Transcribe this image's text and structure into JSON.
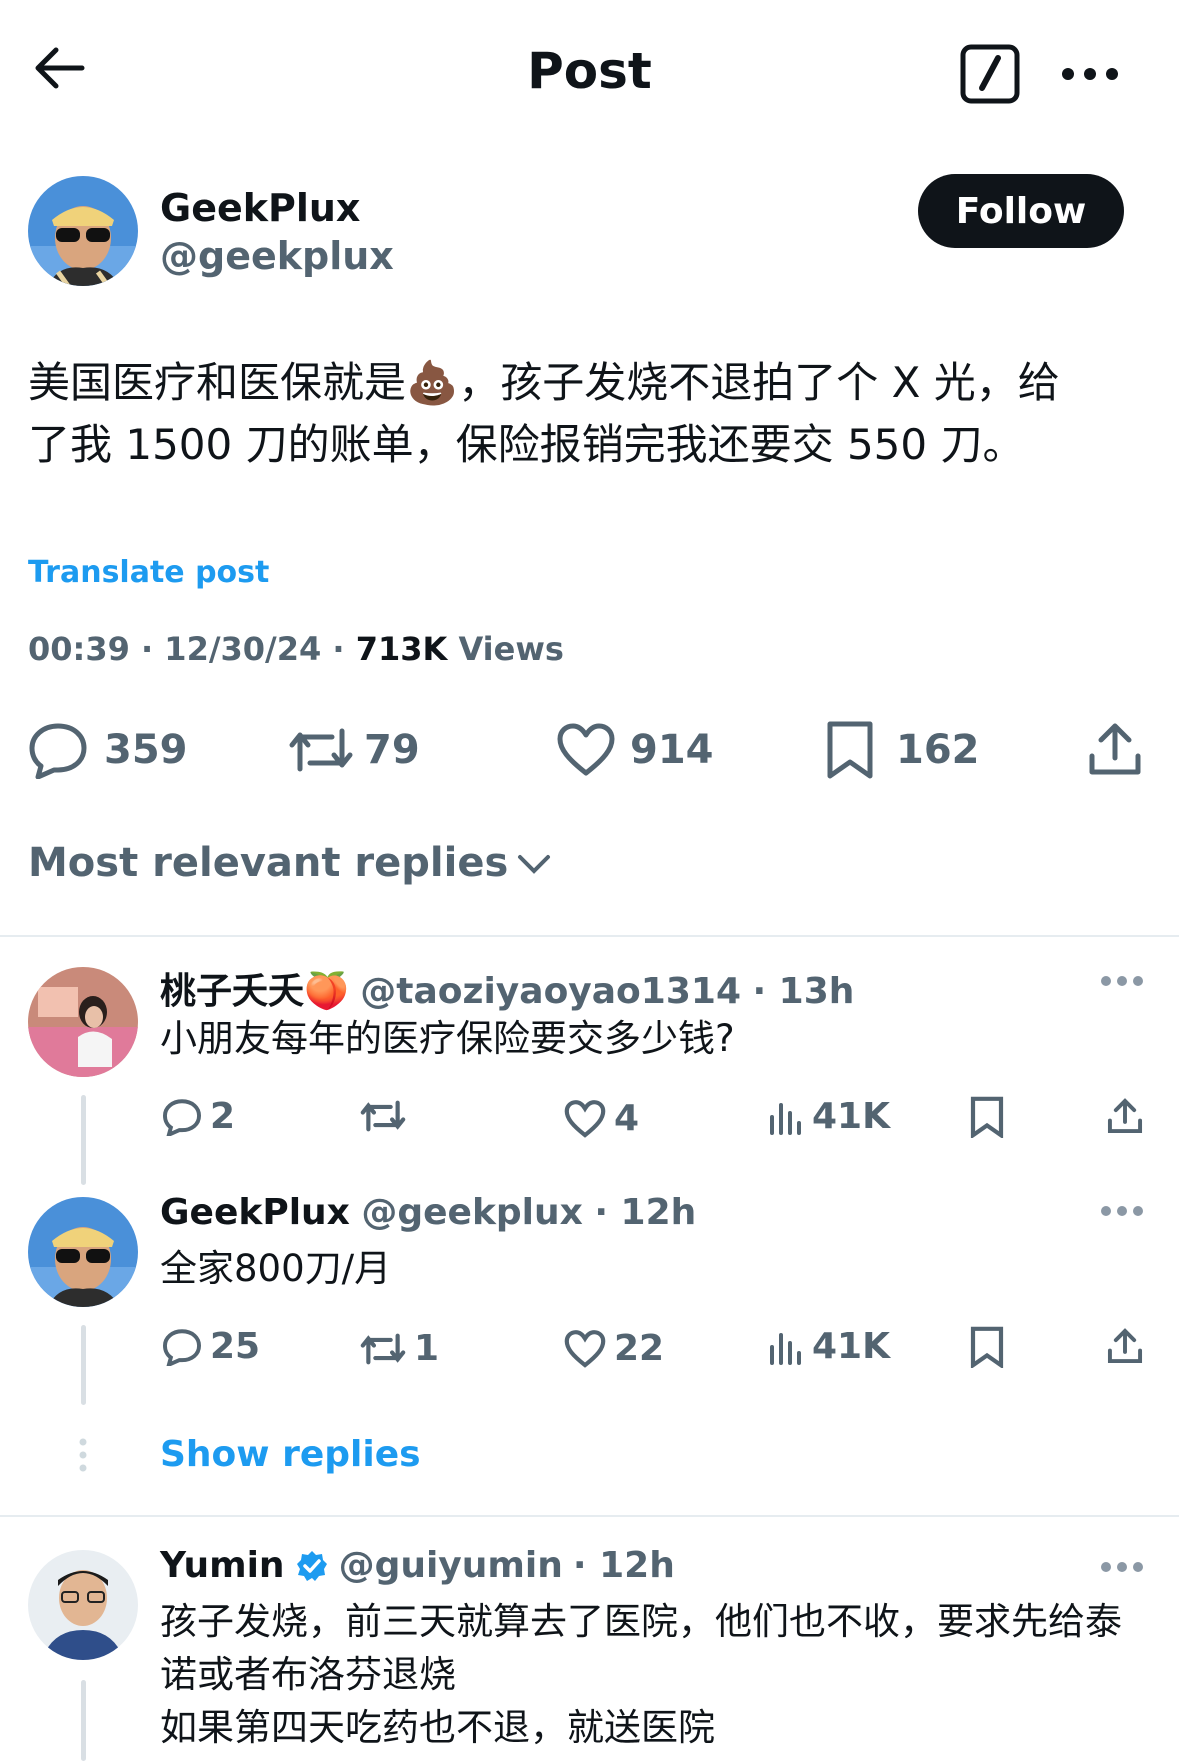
{
  "header": {
    "title": "Post"
  },
  "post": {
    "author_name": "GeekPlux",
    "author_handle": "@geekplux",
    "follow_label": "Follow",
    "text_line1": "美国医疗和医保就是💩，孩子发烧不退拍了个 X 光，给",
    "text_line2": "了我 1500 刀的账单，保险报销完我还要交 550 刀。",
    "translate_label": "Translate post",
    "time": "00:39",
    "date": "12/30/24",
    "views_count": "713K",
    "views_label": "Views",
    "sep": "·",
    "replies": "359",
    "reposts": "79",
    "likes": "914",
    "bookmarks": "162"
  },
  "sort": {
    "label": "Most relevant replies"
  },
  "replies": [
    {
      "name": "桃子夭夭🍑",
      "handle": "@taoziyaoyao1314",
      "time": "· 13h",
      "text": "小朋友每年的医疗保险要交多少钱?",
      "replies": "2",
      "reposts": "",
      "likes": "4",
      "views": "41K"
    },
    {
      "name": "GeekPlux",
      "handle": "@geekplux",
      "time": "· 12h",
      "text": "全家800刀/月",
      "replies": "25",
      "reposts": "1",
      "likes": "22",
      "views": "41K"
    },
    {
      "name": "Yumin",
      "handle": "@guiyumin",
      "time": "· 12h",
      "text_line1": "孩子发烧，前三天就算去了医院，他们也不收，要求先给泰",
      "text_line2": "诺或者布洛芬退烧",
      "text_line3": "如果第四天吃药也不退，就送医院"
    }
  ],
  "show_replies_label": "Show replies",
  "colors": {
    "accent": "#1d9bf0",
    "text": "#0f1419",
    "secondary": "#536471",
    "follow_bg": "#0f1419"
  }
}
